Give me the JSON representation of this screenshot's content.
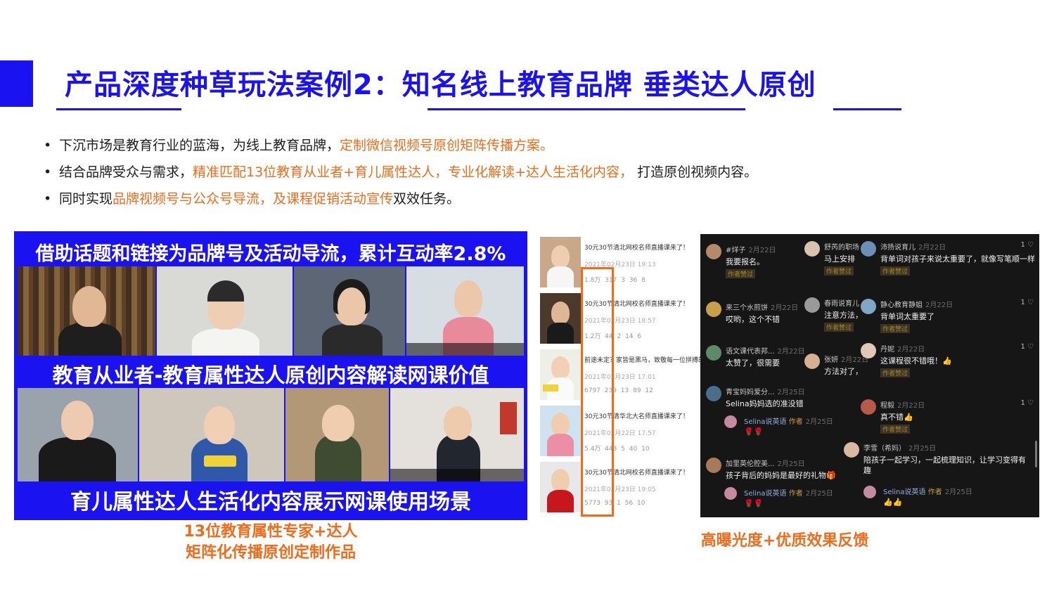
{
  "title": "产品深度种草玩法案例2：知名线上教育品牌  垂类达人原创",
  "bullets": [
    {
      "normal": "下沉市场是教育行业的蓝海，为线上教育品牌，",
      "highlight": "定制微信视频号原创矩阵传播方案。",
      "tail": ""
    },
    {
      "normal": "结合品牌受众与需求，",
      "highlight": "精准匹配13位教育从业者+育儿属性达人，专业化解读+达人生活化内容，",
      "tail": " 打造原创视频内容。"
    },
    {
      "normal": "同时实现",
      "highlight": "品牌视频号与公众号导流，及课程促销活动宣传",
      "tail": "双效任务。"
    }
  ],
  "collage": {
    "banner_top": "借助话题和链接为品牌号及活动导流，累计互动率2.8%",
    "banner_mid": "教育从业者-教育属性达人原创内容解读网课价值",
    "banner_bottom": "育儿属性达人生活化内容展示网课使用场景",
    "caption_line1": "13位教育属性专家+达人",
    "caption_line2": "矩阵化传播原创定制作品",
    "colors": {
      "frame": "#1a12f0",
      "accent": "#f06b1a"
    }
  },
  "videos": [
    {
      "title": "30元30节清北网校名师直播课来了！",
      "date": "2021年02月23日 19:13",
      "stats": "1.8万  317  3  36  8"
    },
    {
      "title": "30元30节清北网校名师直播课来了！",
      "date": "2021年02月23日 18:57",
      "stats": "1.2万  44  2  14  6"
    },
    {
      "title": "前途未定？家皆是黑马，致敬每一位拼搏的",
      "date": "2021年02月23日 17:01",
      "stats": "6797  239  13  89  12"
    },
    {
      "title": "30元30节清华北大名师直播课来了！",
      "date": "2021年02月22日 17:57",
      "stats": "5.4万  443  5  40  10"
    },
    {
      "title": "30元30节清北网校名师直播课来了！",
      "date": "2021年02月23日 19:05",
      "stats": "5773  93  1  56  10"
    }
  ],
  "comments": {
    "author_tag": "作者赞过",
    "items": [
      {
        "name": "#烊子",
        "date": "2月22日",
        "text": "我要报名。",
        "tag": true,
        "like": ""
      },
      {
        "name": "舒芮的职场",
        "date": "",
        "text": "马上安排",
        "tag": true,
        "like": ""
      },
      {
        "name": "沛扬说育儿",
        "date": "2月22日",
        "text": "背单词对孩子来说太重要了，就像写笔顺一样",
        "tag": true,
        "like": "1 ♡"
      },
      {
        "name": "来三个水煎饼",
        "date": "2月22日",
        "text": "哎哟，这个不错",
        "tag": false,
        "like": ""
      },
      {
        "name": "春雨说育儿",
        "date": "",
        "text": "注意方法，",
        "tag": true,
        "like": ""
      },
      {
        "name": "静心教育静姐",
        "date": "2月22日",
        "text": "背单词太重要了",
        "tag": true,
        "like": "1 ♡"
      },
      {
        "name": "语文课代表邦...",
        "date": "2月22日",
        "text": "太赞了，很需要",
        "tag": false,
        "like": ""
      },
      {
        "name": "张妍",
        "date": "2月22日",
        "text": "方法对了，",
        "tag": true,
        "like": ""
      },
      {
        "name": "丹妮",
        "date": "2月22日",
        "text": "这课程很不错哦！👍",
        "tag": true,
        "like": "1 ♡"
      },
      {
        "name": "青宝妈妈爱分...",
        "date": "2月25日",
        "text": "Selina妈妈选的准没错",
        "tag": false,
        "like": ""
      },
      {
        "name": "程毅",
        "date": "2月22日",
        "text": "真不错👍",
        "tag": true,
        "like": "1 ♡"
      },
      {
        "name": "李雪（希妈）",
        "date": "2月25日",
        "text": "陪孩子一起学习，一起梳理知识，让学习变得有",
        "tag": false,
        "like": ""
      },
      {
        "name": "加里英伦腔美...",
        "date": "2月25日",
        "text": "孩子背后的妈妈是最好的礼物🎁",
        "tag": false,
        "like": ""
      }
    ],
    "continuation": "趣",
    "replies": [
      {
        "name": "Selina说英语",
        "role": "作者",
        "date": "2月25日",
        "text": "🌹🌹"
      },
      {
        "name": "Selina说英语",
        "role": "作者",
        "date": "2月25日",
        "text": "🌹🌹"
      },
      {
        "name": "Selina说英语",
        "role": "作者",
        "date": "2月25日",
        "text": "👍👍"
      }
    ],
    "caption": "高曝光度+优质效果反馈"
  }
}
